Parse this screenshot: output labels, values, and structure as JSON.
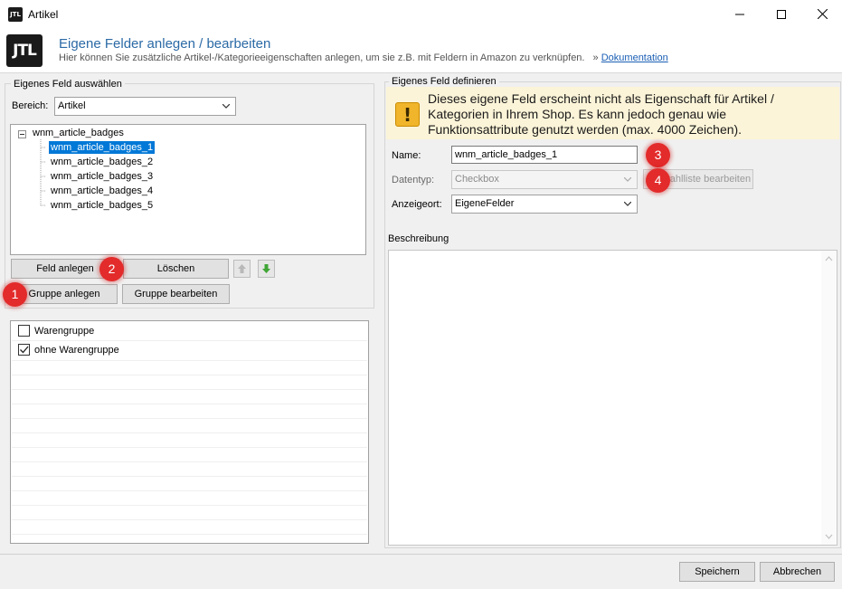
{
  "window": {
    "title": "Artikel",
    "app_icon_text": "JTL"
  },
  "header": {
    "logo_text": "JTL",
    "title": "Eigene Felder anlegen / bearbeiten",
    "subtitle": "Hier können Sie zusätzliche Artikel-/Kategorieeigenschaften anlegen, um sie z.B. mit Feldern in Amazon zu verknüpfen.",
    "link_prefix": "»",
    "link_text": "Dokumentation"
  },
  "left": {
    "group_title": "Eigenes Feld auswählen",
    "bereich_label": "Bereich:",
    "bereich_value": "Artikel",
    "tree": {
      "root": "wnm_article_badges",
      "children": [
        "wnm_article_badges_1",
        "wnm_article_badges_2",
        "wnm_article_badges_3",
        "wnm_article_badges_4",
        "wnm_article_badges_5"
      ],
      "selected_index": 0
    },
    "buttons": {
      "feld_anlegen": "Feld anlegen",
      "loeschen": "Löschen",
      "gruppe_anlegen": "Gruppe anlegen",
      "gruppe_bearbeiten": "Gruppe bearbeiten"
    },
    "checklist": [
      {
        "label": "Warengruppe",
        "checked": false
      },
      {
        "label": "ohne Warengruppe",
        "checked": true
      }
    ]
  },
  "right": {
    "group_title": "Eigenes Feld definieren",
    "warning": "Dieses eigene Feld erscheint nicht als Eigenschaft für Artikel / Kategorien in Ihrem Shop. Es kann jedoch genau wie Funktionsattribute genutzt werden (max. 4000 Zeichen).",
    "name_label": "Name:",
    "name_value": "wnm_article_badges_1",
    "datentyp_label": "Datentyp:",
    "datentyp_value": "Checkbox",
    "auswahlliste_button": "Auswahlliste bearbeiten",
    "anzeigeort_label": "Anzeigeort:",
    "anzeigeort_value": "EigeneFelder",
    "beschreibung_label": "Beschreibung",
    "beschreibung_value": ""
  },
  "annotations": [
    "1",
    "2",
    "3",
    "4"
  ],
  "footer": {
    "save": "Speichern",
    "cancel": "Abbrechen"
  },
  "colors": {
    "selection": "#0078d7",
    "header_title": "#2b6aa6",
    "badge": "#e32b2b",
    "warning_bg": "#fcf4d8"
  }
}
